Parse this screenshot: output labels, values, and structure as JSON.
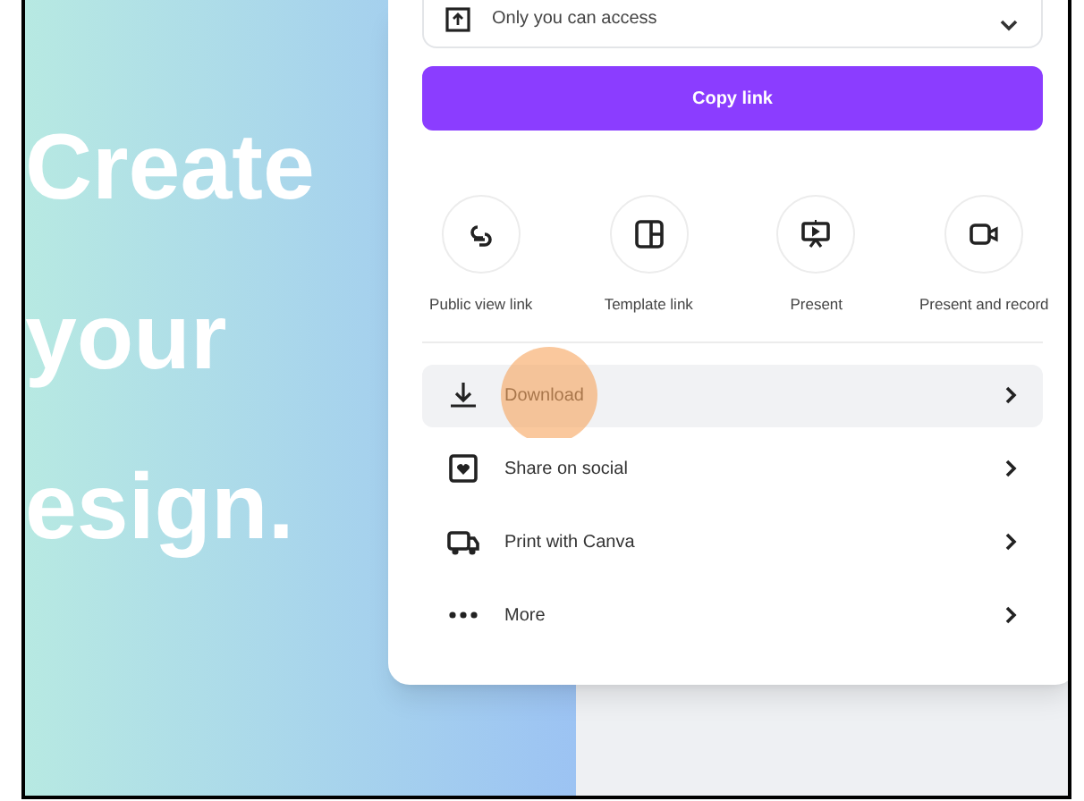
{
  "canvas": {
    "heading_lines": [
      "Create",
      "your",
      "esign."
    ]
  },
  "access_field": {
    "value": "Only you can access"
  },
  "copy_button": {
    "label": "Copy link"
  },
  "share_options": [
    {
      "kind": "link",
      "label": "Public view link"
    },
    {
      "kind": "template",
      "label": "Template link"
    },
    {
      "kind": "present",
      "label": "Present"
    },
    {
      "kind": "record",
      "label": "Present and record"
    }
  ],
  "menu": [
    {
      "kind": "download",
      "label": "Download",
      "selected": true
    },
    {
      "kind": "social",
      "label": "Share on social",
      "selected": false
    },
    {
      "kind": "print",
      "label": "Print with Canva",
      "selected": false
    },
    {
      "kind": "more",
      "label": "More",
      "selected": false
    }
  ]
}
